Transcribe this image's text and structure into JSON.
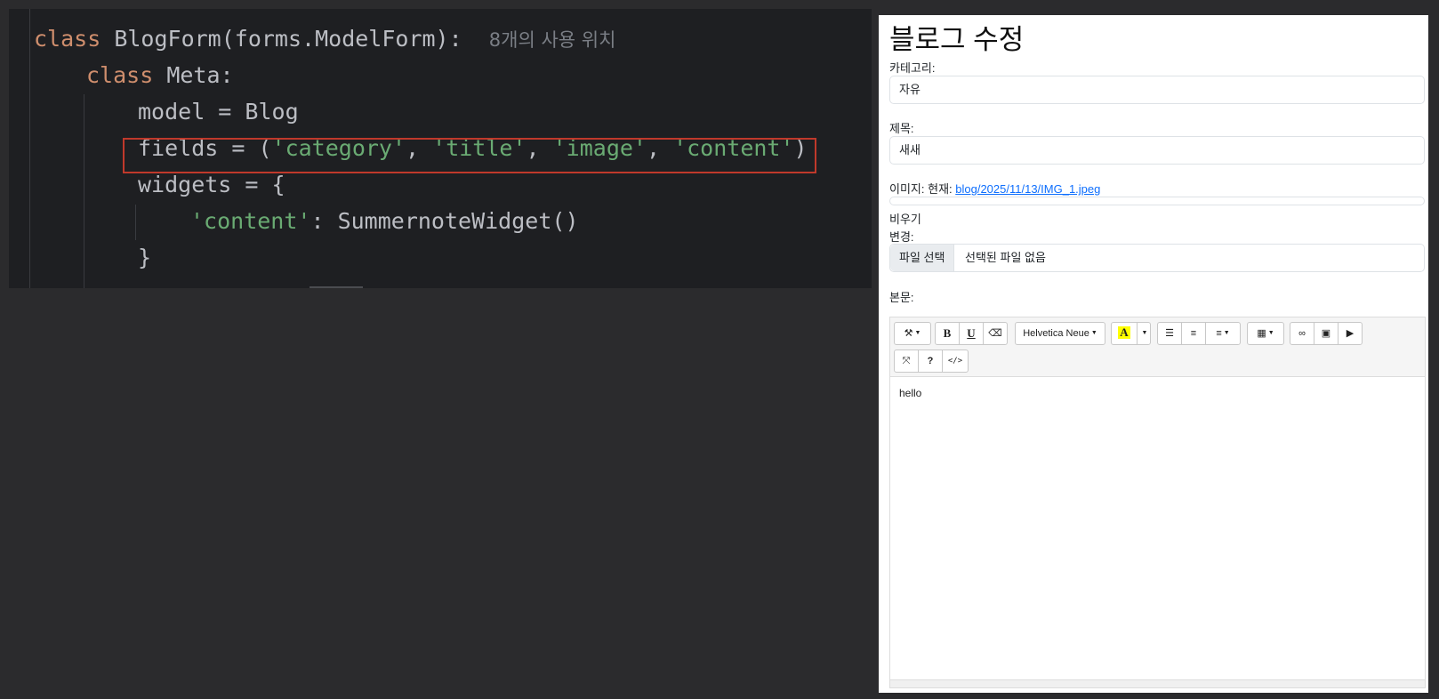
{
  "code": {
    "line1": {
      "kw": "class",
      "rest": " BlogForm(forms.ModelForm):",
      "hint": "8개의 사용 위치"
    },
    "line2": {
      "kw": "class",
      "rest": " Meta:"
    },
    "line3": "model = Blog",
    "line4": {
      "pre": "fields = (",
      "s1": "'category'",
      "c1": ", ",
      "s2": "'title'",
      "c2": ", ",
      "s3": "'image'",
      "c3": ", ",
      "s4": "'content'",
      "post": ")"
    },
    "line5": "widgets = {",
    "line6": {
      "s": "'content'",
      "rest": ": SummernoteWidget()"
    },
    "line7": "}",
    "colors": {
      "keyword": "#cf8e6d",
      "string": "#6aab73",
      "text": "#bcbec4",
      "highlight_box": "#c0392b"
    }
  },
  "form": {
    "title": "블로그 수정",
    "category_label": "카테고리:",
    "category_value": "자유",
    "title_label": "제목:",
    "title_value": "새새",
    "image_label": "이미지: 현재:",
    "image_link": "blog/2025/11/13/IMG_1.jpeg",
    "clear_label": "비우기",
    "change_label": "변경:",
    "file_button": "파일 선택",
    "file_status": "선택된 파일 없음",
    "content_label": "본문:",
    "editor": {
      "font_name": "Helvetica Neue",
      "bold": "B",
      "underline": "U",
      "help": "?",
      "code_view": "</>",
      "highlight": "A",
      "content": "hello"
    }
  }
}
